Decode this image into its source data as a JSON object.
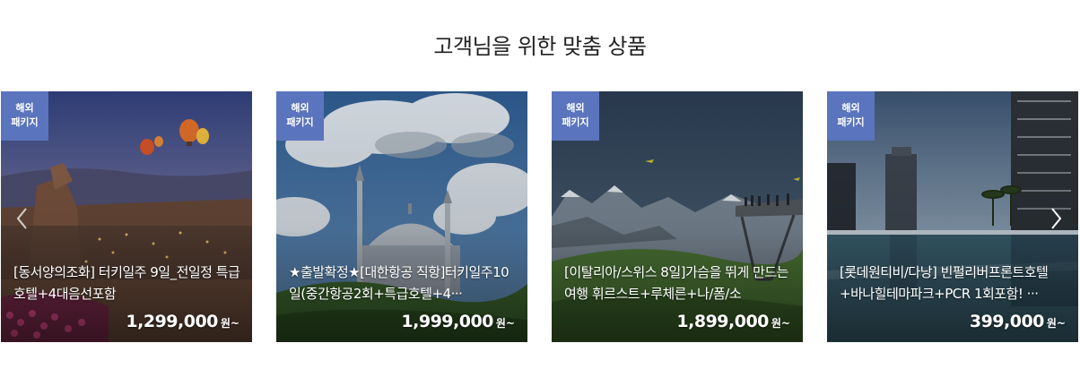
{
  "section": {
    "title": "고객님을 위한 맞춤 상품"
  },
  "colors": {
    "badge": "#5a74bd",
    "text_on_image": "#ffffff"
  },
  "icons": {
    "prev": "chevron-left-icon",
    "next": "chevron-right-icon"
  },
  "products": [
    {
      "badge_line1": "해외",
      "badge_line2": "패키지",
      "title": "[동서양의조화] 터키일주 9일_전일정 특급호텔+4대음선포함",
      "price": "1,299,000",
      "unit": "원~"
    },
    {
      "badge_line1": "해외",
      "badge_line2": "패키지",
      "title": "★출발확정★[대한항공 직항]터키일주10일(중간항공2회+특급호텔+4···",
      "price": "1,999,000",
      "unit": "원~"
    },
    {
      "badge_line1": "해외",
      "badge_line2": "패키지",
      "title": "[이탈리아/스위스 8일]가슴을 뛰게 만드는 여행 휘르스트+루체른+나/폼/소",
      "price": "1,899,000",
      "unit": "원~"
    },
    {
      "badge_line1": "해외",
      "badge_line2": "패키지",
      "title": "[롯데원티비/다낭] 빈펄리버프론트호텔+바나힐테마파크+PCR 1회포함! ···",
      "price": "399,000",
      "unit": "원~"
    }
  ]
}
